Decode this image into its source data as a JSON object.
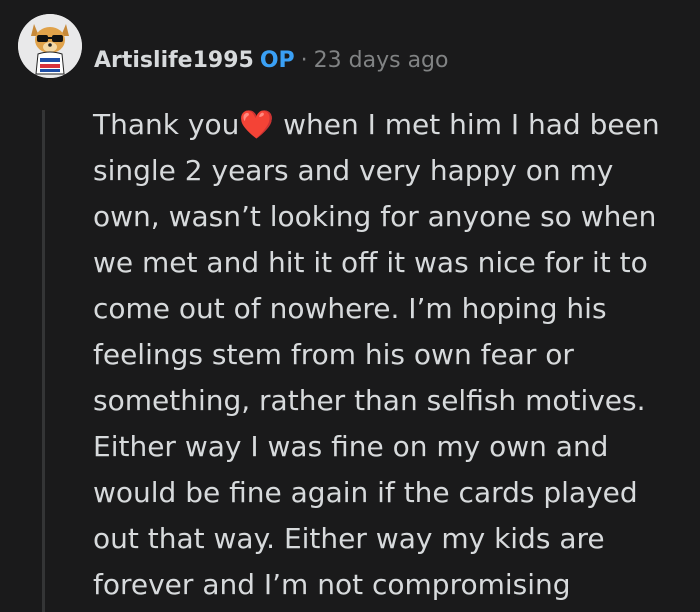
{
  "comment": {
    "author": "Artislife1995",
    "badge": "OP",
    "separator": "·",
    "timestamp": "23 days ago",
    "body": {
      "lead": "Thank you",
      "heart": "❤️",
      "rest": " when I met him I had been single 2 years and very happy on my own, wasn’t looking for anyone so when we met and hit it off it was nice for it to come out of nowhere. I’m hoping his feelings stem from his own fear or something, rather than selfish motives. Either way I was fine on my own and would be fine again if the cards played out that way. Either way my kids are forever and I’m not compromising"
    }
  },
  "colors": {
    "background": "#1a1a1b",
    "text": "#d7dadc",
    "op_badge": "#3aa0f5",
    "muted": "#818384",
    "thread_line": "#343536"
  },
  "icons": {
    "avatar": "snoo-dog-avatar-icon",
    "heart": "red-heart-emoji"
  }
}
